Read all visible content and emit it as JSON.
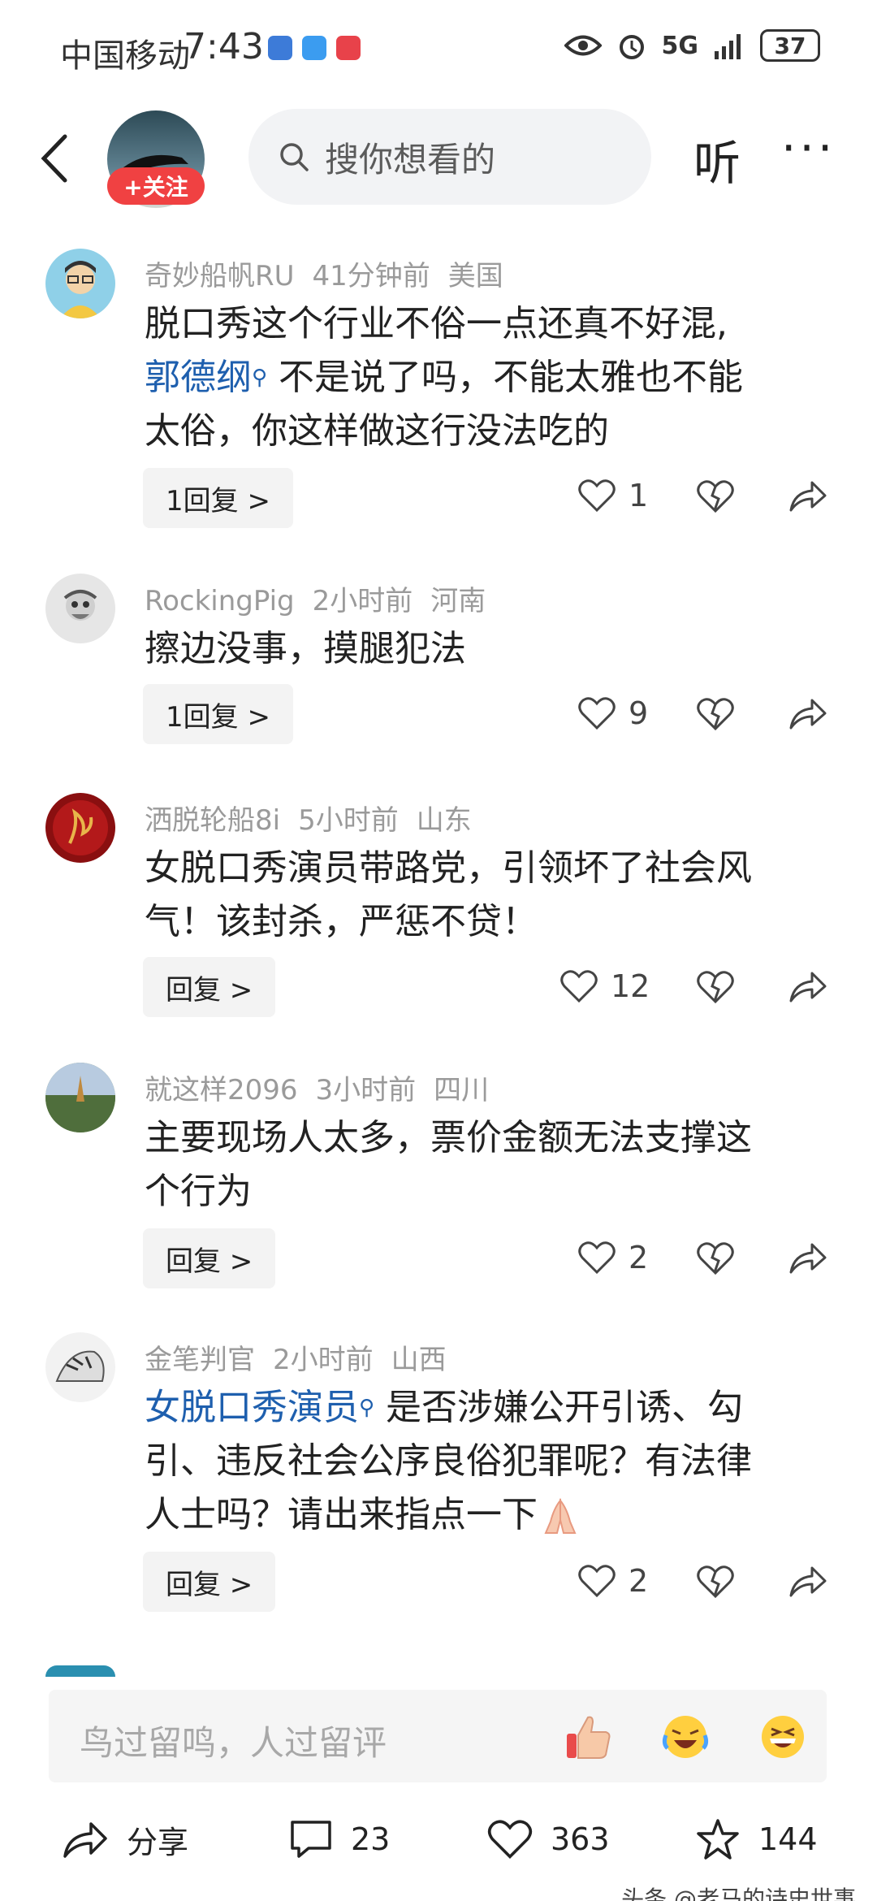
{
  "status_bar": {
    "carrier": "中国移动",
    "time": "7:43",
    "network": "5G",
    "battery": "37"
  },
  "header": {
    "follow_label": "+关注",
    "search_placeholder": "搜你想看的",
    "listen_label": "听",
    "more_label": "···"
  },
  "comments": [
    {
      "author": "奇妙船帆RU",
      "time": "41分钟前",
      "location": "美国",
      "text_lines": [
        "脱口秀这个行业不俗一点还真不好混,"
      ],
      "kw": "郭德纲",
      "kw_rest_1": "不是说了吗，不能太雅也不能",
      "line3": "太俗，你这样做这行没法吃的",
      "reply_label": "1回复 >",
      "likes": "1"
    },
    {
      "author": "RockingPig",
      "time": "2小时前",
      "location": "河南",
      "text": "擦边没事，摸腿犯法",
      "reply_label": "1回复 >",
      "likes": "9"
    },
    {
      "author": "洒脱轮船8i",
      "time": "5小时前",
      "location": "山东",
      "line1": "女脱口秀演员带路党，引领坏了社会风",
      "line2": "气！该封杀，严惩不贷！",
      "reply_label": "回复 >",
      "likes": "12"
    },
    {
      "author": "就这样2096",
      "time": "3小时前",
      "location": "四川",
      "line1": "主要现场人太多，票价金额无法支撑这",
      "line2": "个行为",
      "reply_label": "回复 >",
      "likes": "2"
    },
    {
      "author": "金笔判官",
      "time": "2小时前",
      "location": "山西",
      "kw": "女脱口秀演员",
      "kw_rest_1": "是否涉嫌公开引诱、勾",
      "line2": "引、违反社会公序良俗犯罪呢？有法律",
      "line3": "人士吗？请出来指点一下",
      "reply_label": "回复 >",
      "likes": "2"
    }
  ],
  "input": {
    "placeholder": "鸟过留鸣，人过留评"
  },
  "bottom_bar": {
    "share_label": "分享",
    "comment_count": "23",
    "like_count": "363",
    "fav_count": "144"
  },
  "watermark": "头条 @老马的诗史世事",
  "icons": [
    "back-arrow-icon",
    "search-icon",
    "heart-icon",
    "dislike-heart-icon",
    "share-icon",
    "comment-icon",
    "star-icon"
  ]
}
